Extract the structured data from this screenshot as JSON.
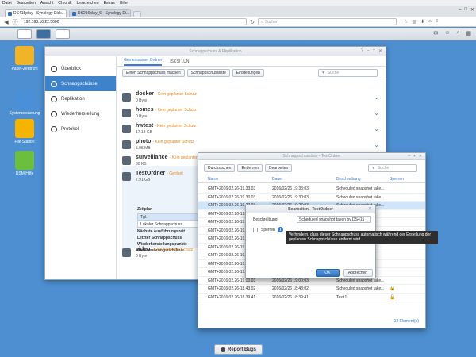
{
  "os_menu": [
    "Datei",
    "Bearbeiten",
    "Ansicht",
    "Chronik",
    "Lesezeichen",
    "Extras",
    "Hilfe"
  ],
  "browser": {
    "tabs": [
      {
        "label": "DS415play - Synology Disk...",
        "active": true
      },
      {
        "label": "DS216play_6 - Synology Di...",
        "active": false
      }
    ],
    "url": "192.168.10.22:5000",
    "search_placeholder": "Suchen"
  },
  "desktop_icons": [
    {
      "label": "Paket-Zentrum",
      "color": "#f0b429"
    },
    {
      "label": "Systemsteuerung",
      "color": "#4a90d9"
    },
    {
      "label": "File Station",
      "color": "#f5b400"
    },
    {
      "label": "DSM Hilfe",
      "color": "#6abf3f"
    }
  ],
  "main_window": {
    "title": "Schnappschuss & Replikation",
    "sidebar": [
      {
        "label": "Überblick",
        "active": false
      },
      {
        "label": "Schnappschüsse",
        "active": true
      },
      {
        "label": "Replikation",
        "active": false
      },
      {
        "label": "Wiederherstellung",
        "active": false
      },
      {
        "label": "Protokoll",
        "active": false
      }
    ],
    "tabs": [
      {
        "label": "Gemeinsamer Ordner",
        "active": true
      },
      {
        "label": "iSCSI LUN",
        "active": false
      }
    ],
    "toolbar": [
      "Einen Schnappschuss machen",
      "Schnappschussliste",
      "Einstellungen"
    ],
    "filter_placeholder": "Suche",
    "shares": [
      {
        "name": "docker",
        "status": "- Kein geplanter Schutz",
        "size": "0 Byte"
      },
      {
        "name": "homes",
        "status": "- Kein geplanter Schutz",
        "size": "0 Byte"
      },
      {
        "name": "hwtest",
        "status": "- Kein geplanter Schutz",
        "size": "17.13 GB"
      },
      {
        "name": "photo",
        "status": "- Kein geplanter Schutz",
        "size": "5.05 MB"
      },
      {
        "name": "surveillance",
        "status": "- Kein geplanter Schutz",
        "size": "80 KB"
      },
      {
        "name": "TestOrdner",
        "status": "- Geplant",
        "size": "7.91 GB"
      },
      {
        "name": "video",
        "status": "- Kein geplanter Schutz",
        "size": "0 Byte"
      }
    ],
    "expanded": {
      "schedule_heading": "Zeitplan",
      "schedule_rows": [
        "Tgl.",
        "Lokaler Schnappschuss"
      ],
      "labels": [
        "Nächste Ausführungszeit",
        "Letzter Schnappschuss",
        "Wiederherstellungspunkte",
        "Aufbewahrungsrichtlinie"
      ]
    }
  },
  "list_window": {
    "title": "Schnappschussliste - TestOrdner",
    "toolbar": [
      "Durchsuchen",
      "Entfernen",
      "Bearbeiten"
    ],
    "filter_placeholder": "Suche",
    "columns": [
      "Name",
      "Dauer",
      "Beschreibung",
      "Sperren"
    ],
    "rows": [
      {
        "name": "GMT+2016.02.26-19.33.03",
        "time": "2016/02/26 19:33:03",
        "desc": "Scheduled snapshot take...",
        "lock": false,
        "selected": false
      },
      {
        "name": "GMT+2016.02.26-19.30.03",
        "time": "2016/02/26 19:30:03",
        "desc": "Scheduled snapshot take...",
        "lock": false,
        "selected": false
      },
      {
        "name": "GMT+2016.02.26-19.27.03",
        "time": "2016/02/26 19:27:03",
        "desc": "Scheduled snapshot take...",
        "lock": false,
        "selected": true
      },
      {
        "name": "GMT+2016.02.26-19.24.03",
        "time": "",
        "desc": "",
        "lock": false,
        "selected": false
      },
      {
        "name": "GMT+2016.02.26-19.21.03",
        "time": "",
        "desc": "",
        "lock": false,
        "selected": false
      },
      {
        "name": "GMT+2016.02.26-19.18.03",
        "time": "",
        "desc": "",
        "lock": false,
        "selected": false
      },
      {
        "name": "GMT+2016.02.26-19.15.03",
        "time": "",
        "desc": "",
        "lock": false,
        "selected": false
      },
      {
        "name": "GMT+2016.02.26-19.12.03",
        "time": "",
        "desc": "",
        "lock": false,
        "selected": false
      },
      {
        "name": "GMT+2016.02.26-19.09.03",
        "time": "",
        "desc": "",
        "lock": false,
        "selected": false
      },
      {
        "name": "GMT+2016.02.26-19.06.03",
        "time": "",
        "desc": "",
        "lock": false,
        "selected": false
      },
      {
        "name": "GMT+2016.02.26-19.03.03",
        "time": "",
        "desc": "",
        "lock": false,
        "selected": false
      },
      {
        "name": "GMT+2016.02.26-19.00.03",
        "time": "2016/02/26 19:00:03",
        "desc": "Scheduled snapshot take...",
        "lock": false,
        "selected": false
      },
      {
        "name": "GMT+2016.02.26-18.43.02",
        "time": "2016/02/26 18:43:02",
        "desc": "Scheduled snapshot take...",
        "lock": true,
        "selected": false
      },
      {
        "name": "GMT+2016.02.26-18.39.41",
        "time": "2016/02/26 18:39:41",
        "desc": "Test 1",
        "lock": true,
        "selected": false
      }
    ],
    "count": "13 Element(e)"
  },
  "edit_dialog": {
    "title": "Bearbeiten - TestOrdner",
    "desc_label": "Beschreibung:",
    "desc_value": "Scheduled snapshot taken by DS415",
    "lock_label": "Sperren",
    "ok": "OK",
    "cancel": "Abbrechen"
  },
  "tooltip": "Verhindern, dass dieser Schnappschuss automatisch während der Erstellung der geplanten Schnappschüsse entfernt wird.",
  "report_bugs": "Report Bugs"
}
